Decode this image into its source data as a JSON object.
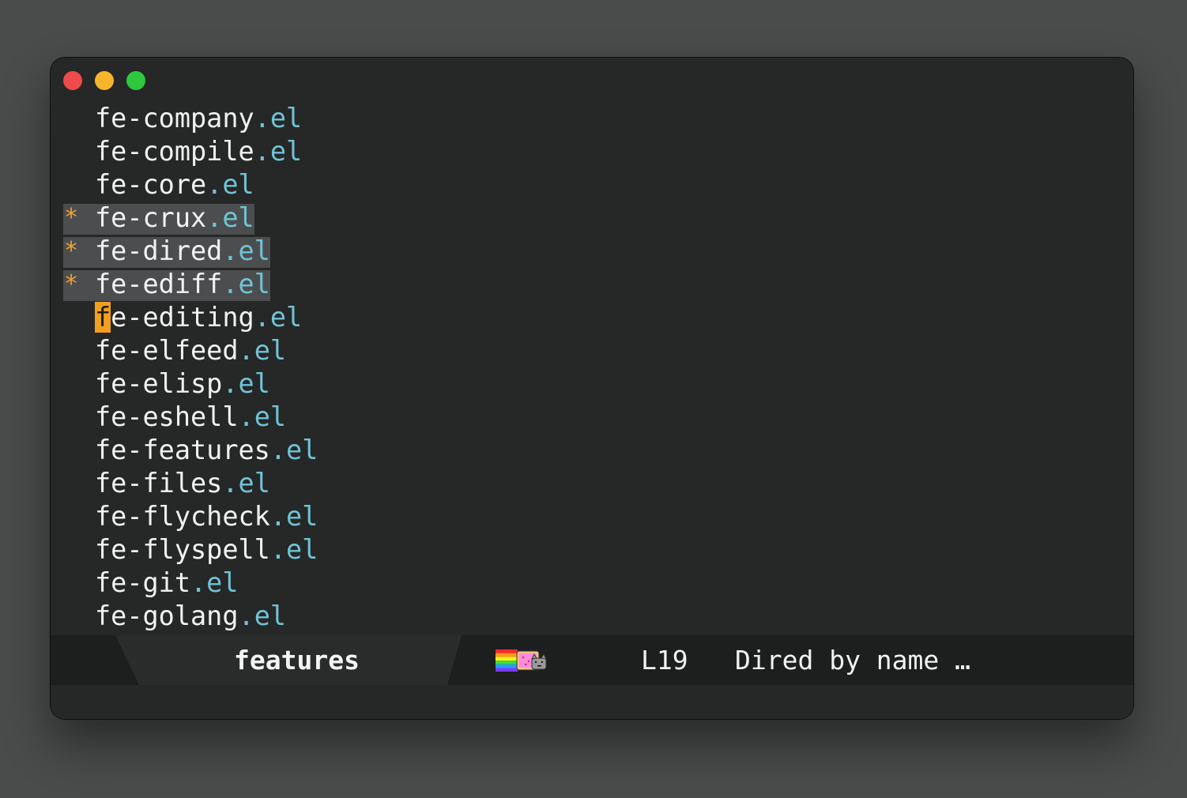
{
  "window": {
    "traffic_lights": [
      "close",
      "minimize",
      "zoom"
    ]
  },
  "files": [
    {
      "name": "fe-company",
      "ext": ".el",
      "marked": false,
      "cursor": false
    },
    {
      "name": "fe-compile",
      "ext": ".el",
      "marked": false,
      "cursor": false
    },
    {
      "name": "fe-core",
      "ext": ".el",
      "marked": false,
      "cursor": false
    },
    {
      "name": "fe-crux",
      "ext": ".el",
      "marked": true,
      "cursor": false
    },
    {
      "name": "fe-dired",
      "ext": ".el",
      "marked": true,
      "cursor": false
    },
    {
      "name": "fe-ediff",
      "ext": ".el",
      "marked": true,
      "cursor": false
    },
    {
      "name": "fe-editing",
      "ext": ".el",
      "marked": false,
      "cursor": true
    },
    {
      "name": "fe-elfeed",
      "ext": ".el",
      "marked": false,
      "cursor": false
    },
    {
      "name": "fe-elisp",
      "ext": ".el",
      "marked": false,
      "cursor": false
    },
    {
      "name": "fe-eshell",
      "ext": ".el",
      "marked": false,
      "cursor": false
    },
    {
      "name": "fe-features",
      "ext": ".el",
      "marked": false,
      "cursor": false
    },
    {
      "name": "fe-files",
      "ext": ".el",
      "marked": false,
      "cursor": false
    },
    {
      "name": "fe-flycheck",
      "ext": ".el",
      "marked": false,
      "cursor": false
    },
    {
      "name": "fe-flyspell",
      "ext": ".el",
      "marked": false,
      "cursor": false
    },
    {
      "name": "fe-git",
      "ext": ".el",
      "marked": false,
      "cursor": false
    },
    {
      "name": "fe-golang",
      "ext": ".el",
      "marked": false,
      "cursor": false
    }
  ],
  "mark_symbol": "*",
  "modeline": {
    "buffer_name": "features",
    "nyan_icon": "nyan-cat-icon",
    "line": "L19",
    "mode": "Dired by name …"
  },
  "colors": {
    "background": "#262727",
    "extension": "#6fc3d6",
    "mark": "#f0a030",
    "cursor": "#f0a01e",
    "marked_line": "#4c4d4e"
  }
}
